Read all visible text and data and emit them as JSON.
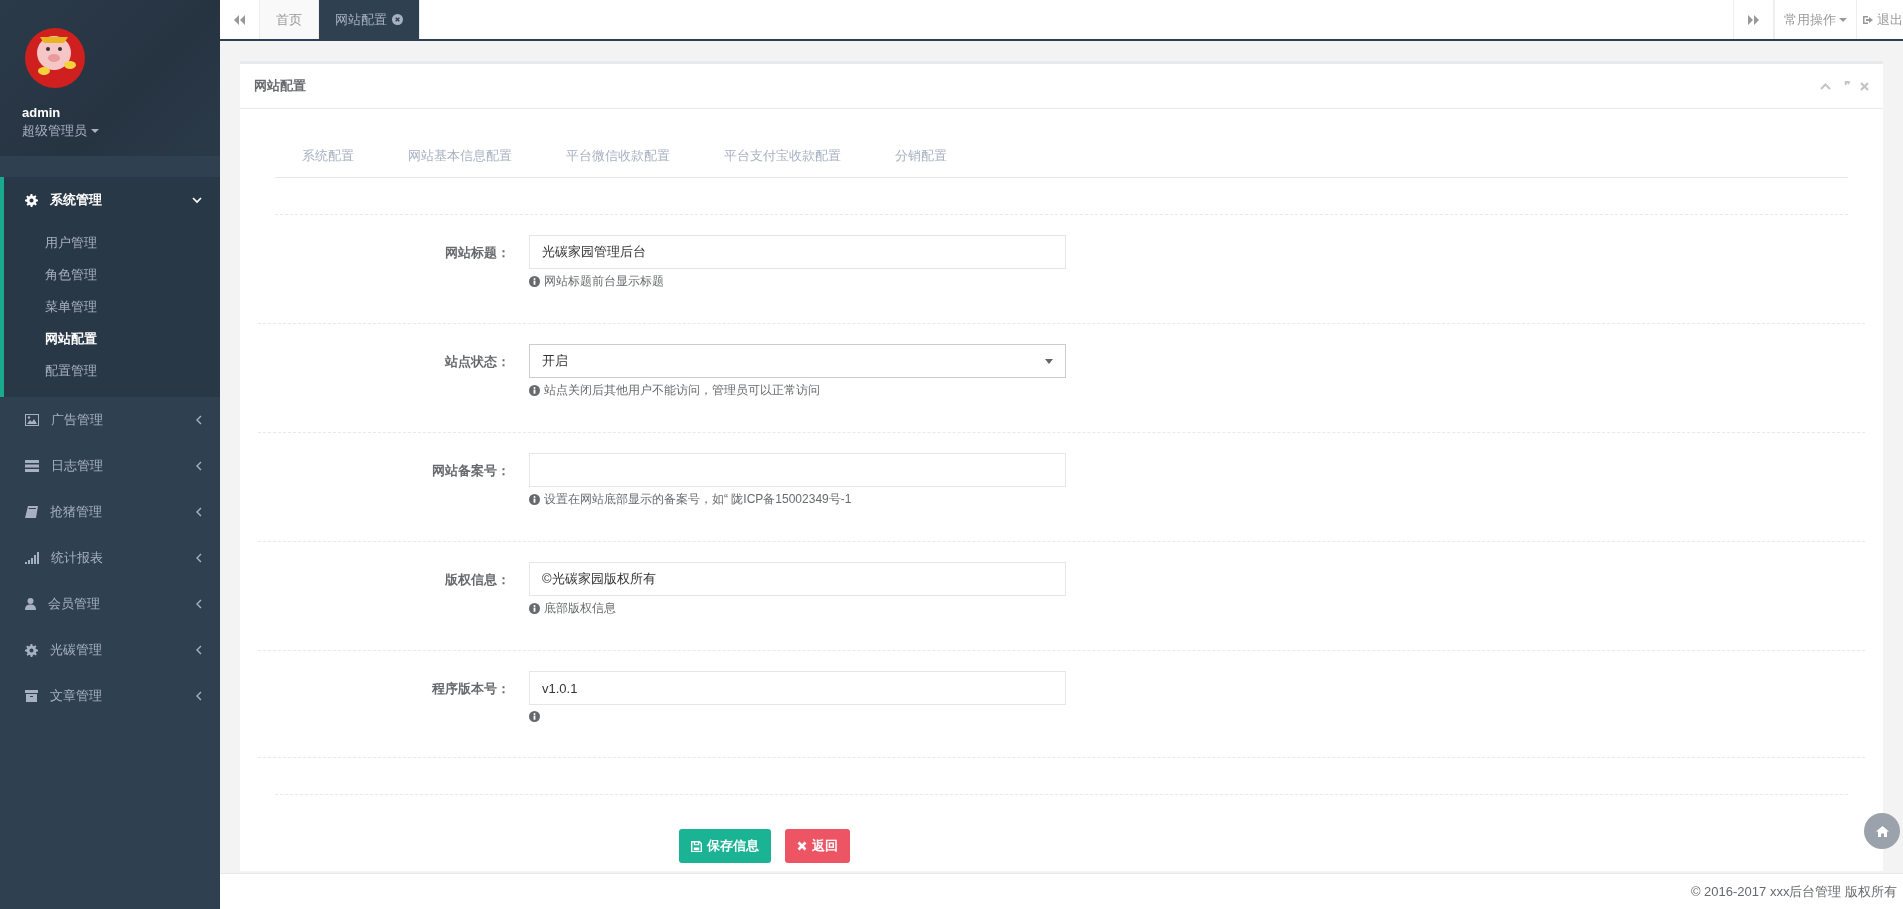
{
  "sidebar": {
    "user": {
      "name": "admin",
      "role": "超级管理员"
    },
    "menu": [
      {
        "label": "系统管理",
        "expanded": true,
        "children": [
          {
            "label": "用户管理",
            "selected": false
          },
          {
            "label": "角色管理",
            "selected": false
          },
          {
            "label": "菜单管理",
            "selected": false
          },
          {
            "label": "网站配置",
            "selected": true
          },
          {
            "label": "配置管理",
            "selected": false
          }
        ]
      },
      {
        "label": "广告管理",
        "expanded": false
      },
      {
        "label": "日志管理",
        "expanded": false
      },
      {
        "label": "抢猪管理",
        "expanded": false
      },
      {
        "label": "统计报表",
        "expanded": false
      },
      {
        "label": "会员管理",
        "expanded": false
      },
      {
        "label": "光碳管理",
        "expanded": false
      },
      {
        "label": "文章管理",
        "expanded": false
      }
    ]
  },
  "topbar": {
    "tabs": [
      {
        "label": "首页",
        "selected": false,
        "closable": false
      },
      {
        "label": "网站配置",
        "selected": true,
        "closable": true
      }
    ],
    "menu_button": "常用操作",
    "logout": "退出"
  },
  "panel": {
    "title": "网站配置",
    "config_tabs": [
      {
        "label": "系统配置"
      },
      {
        "label": "网站基本信息配置"
      },
      {
        "label": "平台微信收款配置"
      },
      {
        "label": "平台支付宝收款配置"
      },
      {
        "label": "分销配置"
      }
    ],
    "fields": [
      {
        "kind": "text",
        "label": "网站标题：",
        "value": "光碳家园管理后台",
        "help": "网站标题前台显示标题"
      },
      {
        "kind": "select",
        "label": "站点状态：",
        "value": "开启",
        "help": "站点关闭后其他用户不能访问，管理员可以正常访问"
      },
      {
        "kind": "text",
        "label": "网站备案号：",
        "help": "设置在网站底部显示的备案号，如“ 陇ICP备15002349号-1"
      },
      {
        "kind": "text",
        "label": "版权信息：",
        "value": "©光碳家园版权所有",
        "help": "底部版权信息"
      },
      {
        "kind": "text",
        "label": "程序版本号：",
        "value": "v1.0.1"
      }
    ],
    "buttons": [
      {
        "kind": "save",
        "label": "保存信息"
      },
      {
        "kind": "back",
        "label": "返回"
      }
    ]
  },
  "footer": "© 2016-2017 xxx后台管理 版权所有"
}
